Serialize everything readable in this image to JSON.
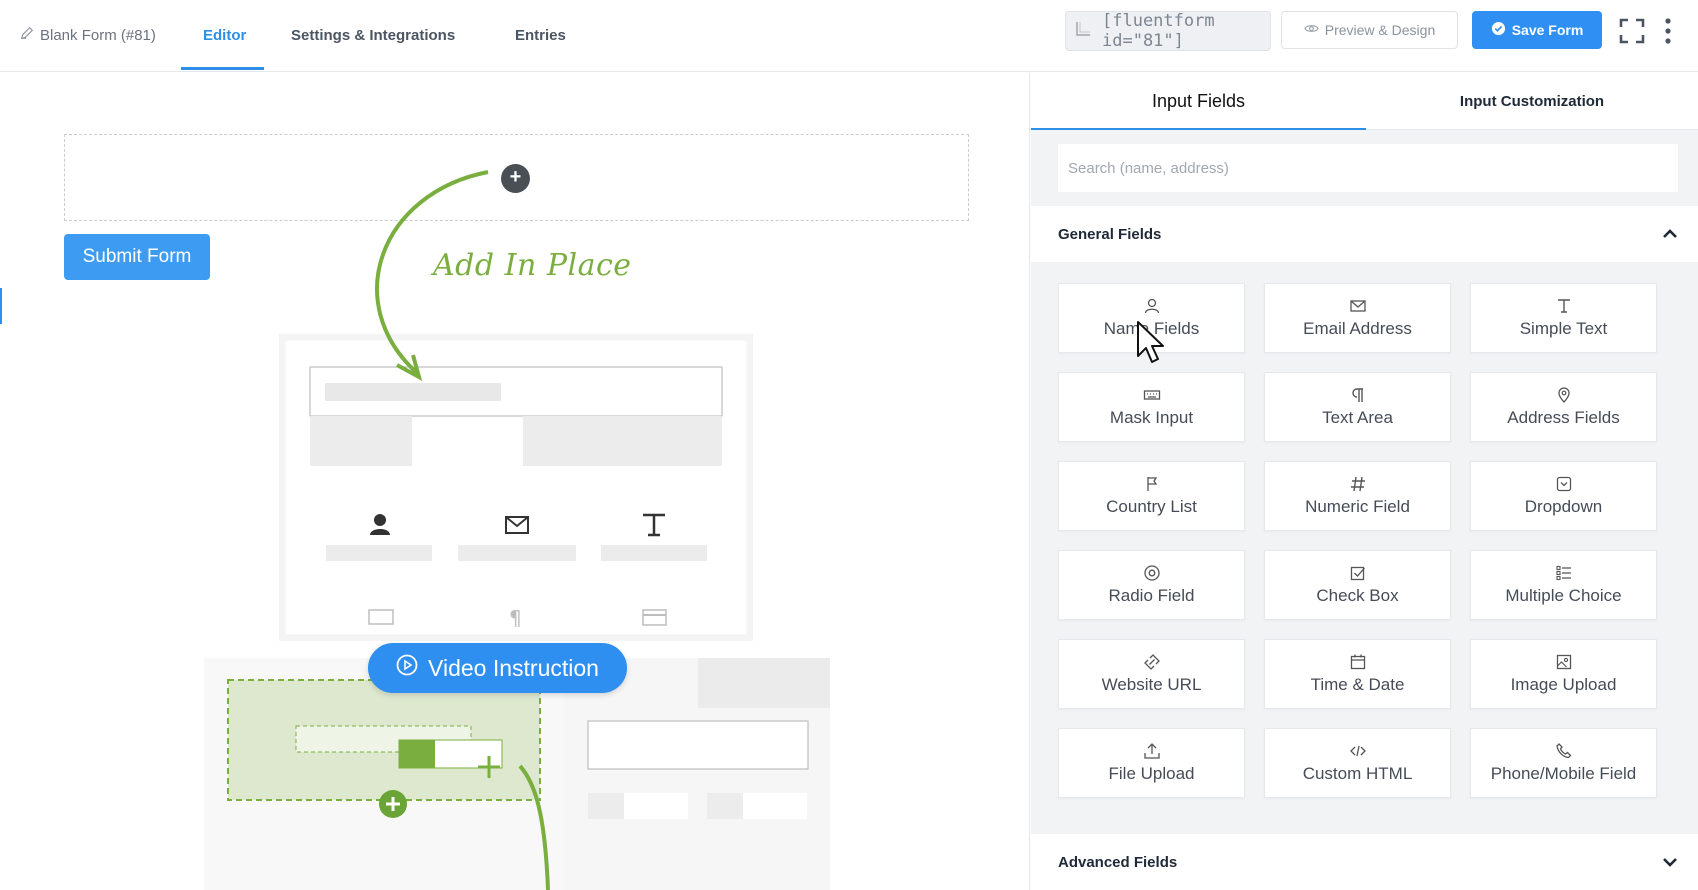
{
  "header": {
    "form_title": "Blank Form (#81)",
    "tabs": [
      {
        "label": "Editor",
        "active": true
      },
      {
        "label": "Settings & Integrations",
        "active": false
      },
      {
        "label": "Entries",
        "active": false
      }
    ],
    "shortcode": "[fluentform id=\"81\"]",
    "preview_label": "Preview & Design",
    "save_label": "Save Form"
  },
  "editor": {
    "submit_label": "Submit Form",
    "add_in_place_label": "Add In Place",
    "video_label": "Video Instruction"
  },
  "panel": {
    "tabs": [
      {
        "label": "Input Fields",
        "active": true
      },
      {
        "label": "Input Customization",
        "active": false
      }
    ],
    "search_placeholder": "Search (name, address)",
    "general_section": "General Fields",
    "advanced_section": "Advanced Fields",
    "fields": [
      {
        "label": "Name Fields",
        "icon": "user-icon"
      },
      {
        "label": "Email Address",
        "icon": "envelope-icon"
      },
      {
        "label": "Simple Text",
        "icon": "text-icon"
      },
      {
        "label": "Mask Input",
        "icon": "keyboard-icon"
      },
      {
        "label": "Text Area",
        "icon": "paragraph-icon"
      },
      {
        "label": "Address Fields",
        "icon": "map-pin-icon"
      },
      {
        "label": "Country List",
        "icon": "flag-icon"
      },
      {
        "label": "Numeric Field",
        "icon": "hash-icon"
      },
      {
        "label": "Dropdown",
        "icon": "dropdown-icon"
      },
      {
        "label": "Radio Field",
        "icon": "radio-icon"
      },
      {
        "label": "Check Box",
        "icon": "checkbox-icon"
      },
      {
        "label": "Multiple Choice",
        "icon": "list-icon"
      },
      {
        "label": "Website URL",
        "icon": "link-icon"
      },
      {
        "label": "Time & Date",
        "icon": "calendar-icon"
      },
      {
        "label": "Image Upload",
        "icon": "image-icon"
      },
      {
        "label": "File Upload",
        "icon": "upload-icon"
      },
      {
        "label": "Custom HTML",
        "icon": "code-icon"
      },
      {
        "label": "Phone/Mobile Field",
        "icon": "phone-icon"
      }
    ]
  },
  "colors": {
    "accent": "#2e8fe8",
    "save_button": "#2f8ff2",
    "illustration_green": "#7aae3f"
  }
}
